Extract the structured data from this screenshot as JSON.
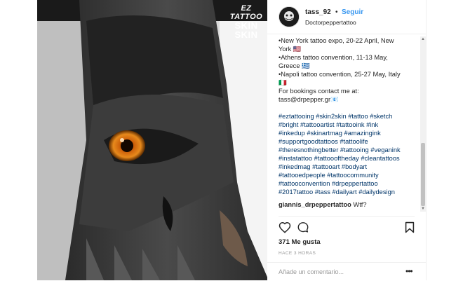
{
  "watermark": {
    "line1": "EZ TATTOO",
    "line2": "SKIN",
    "line3": "SKIN"
  },
  "post": {
    "username": "tass_92",
    "separator": "•",
    "follow_label": "Seguir",
    "subname": "Doctorpeppertattoo"
  },
  "caption": {
    "lines": [
      "•New York tattoo expo, 20-22 April, New",
      "York 🇺🇸",
      "•Athens tattoo convention, 11-13 May,",
      "Greece 🇬🇷",
      "•Napoli tattoo convention, 25-27 May, Italy",
      "🇮🇹",
      "For bookings contact me at:",
      "tass@drpepper.gr📧"
    ],
    "hashtag_lines": [
      "#eztattooing #skin2skin #tattoo #sketch",
      "#bright #tattooartist #tattooink #ink",
      "#inkedup #skinartmag #amazingink",
      "#supportgoodtattoos #tattoolife",
      "#theresnothingbetter #tattooing #veganink",
      "#instatattoo #tattoooftheday #cleantattoos",
      "#inkedmag #tattooart #bodyart",
      "#tattooedpeople #tattoocommunity",
      "#tattooconvention #drpeppertattoo",
      "#2017tattoo #tass #dailyart #dailydesign"
    ]
  },
  "comment": {
    "user": "giannis_drpeppertattoo",
    "text": "Wtf?"
  },
  "stats": {
    "likes": "371 Me gusta",
    "time": "HACE 3 HORAS"
  },
  "comment_box": {
    "placeholder": "Añade un comentario...",
    "more": "•••"
  },
  "icons": {
    "like": "heart-icon",
    "comment": "comment-icon",
    "save": "bookmark-icon",
    "more": "more-icon"
  },
  "colors": {
    "link": "#3897f0",
    "hashtag": "#003569",
    "text": "#262626",
    "muted": "#999999"
  }
}
